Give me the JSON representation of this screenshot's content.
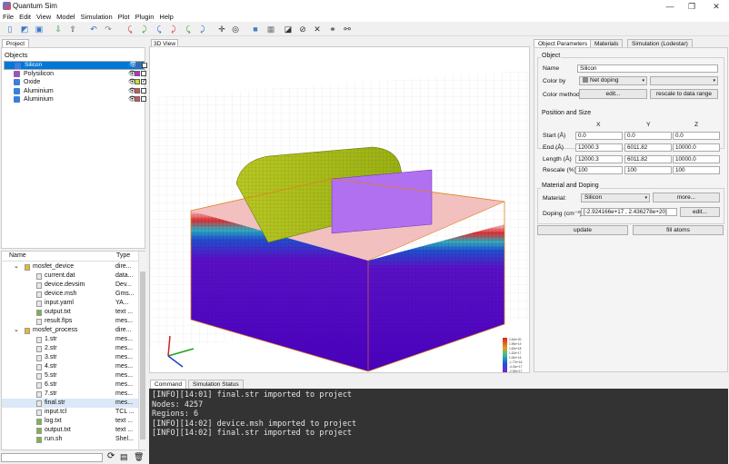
{
  "window": {
    "title": "Quantum Sim",
    "minimize": "—",
    "maximize": "❐",
    "close": "✕"
  },
  "menu": [
    "File",
    "Edit",
    "View",
    "Model",
    "Simulation",
    "Plot",
    "Plugin",
    "Help"
  ],
  "left": {
    "project_tab": "Project",
    "objects_header": "Objects",
    "objects": [
      {
        "label": "Silicon",
        "color": "#3b7fd9",
        "swatch": "#2266dd",
        "checked": true,
        "selected": true
      },
      {
        "label": "Polysilicon",
        "color": "#9b59b6",
        "swatch": "#d020d0",
        "checked": false,
        "selected": false
      },
      {
        "label": "Oxide",
        "color": "#3b7fd9",
        "swatch": "#c8e020",
        "checked": true,
        "selected": false
      },
      {
        "label": "Aluminium",
        "color": "#3b7fd9",
        "swatch": "#e05050",
        "checked": false,
        "selected": false
      },
      {
        "label": "Aluminium",
        "color": "#3b7fd9",
        "swatch": "#e05050",
        "checked": false,
        "selected": false
      }
    ],
    "file_headers": {
      "name": "Name",
      "type": "Type"
    },
    "files": [
      {
        "name": "mosfet_device",
        "type": "dire...",
        "kind": "folder",
        "indent": 0
      },
      {
        "name": "current.dat",
        "type": "data...",
        "kind": "file",
        "indent": 1
      },
      {
        "name": "device.devsim",
        "type": "Dev...",
        "kind": "file",
        "indent": 1
      },
      {
        "name": "device.msh",
        "type": "Gms...",
        "kind": "file",
        "indent": 1
      },
      {
        "name": "input.yaml",
        "type": "YA...",
        "kind": "file",
        "indent": 1
      },
      {
        "name": "output.txt",
        "type": "text ...",
        "kind": "filegreen",
        "indent": 1
      },
      {
        "name": "result.fIps",
        "type": "mes...",
        "kind": "file",
        "indent": 1
      },
      {
        "name": "mosfet_process",
        "type": "dire...",
        "kind": "folder",
        "indent": 0
      },
      {
        "name": "1.str",
        "type": "mes...",
        "kind": "file",
        "indent": 1
      },
      {
        "name": "2.str",
        "type": "mes...",
        "kind": "file",
        "indent": 1
      },
      {
        "name": "3.str",
        "type": "mes...",
        "kind": "file",
        "indent": 1
      },
      {
        "name": "4.str",
        "type": "mes...",
        "kind": "file",
        "indent": 1
      },
      {
        "name": "5.str",
        "type": "mes...",
        "kind": "file",
        "indent": 1
      },
      {
        "name": "6.str",
        "type": "mes...",
        "kind": "file",
        "indent": 1
      },
      {
        "name": "7.str",
        "type": "mes...",
        "kind": "file",
        "indent": 1
      },
      {
        "name": "final.str",
        "type": "mes...",
        "kind": "file",
        "indent": 1
      },
      {
        "name": "input.tcl",
        "type": "TCL ...",
        "kind": "file",
        "indent": 1
      },
      {
        "name": "log.txt",
        "type": "text ...",
        "kind": "filegreen",
        "indent": 1
      },
      {
        "name": "output.txt",
        "type": "text ...",
        "kind": "filegreen",
        "indent": 1
      },
      {
        "name": "run.sh",
        "type": "Shel...",
        "kind": "filegreen",
        "indent": 1
      }
    ]
  },
  "view": {
    "tab": "3D View",
    "axes": {
      "x": "x",
      "y": "y",
      "z": "z"
    }
  },
  "bottom": {
    "tabs": [
      "Command",
      "Simulation Status"
    ],
    "console": [
      "[INFO][14:01] final.str imported to project",
      "Nodes: 4257",
      "Regions: 6",
      "[INFO][14:02] device.msh imported to project",
      "[INFO][14:02] final.str imported to project"
    ]
  },
  "right": {
    "tabs": [
      "Object Parameters",
      "Materials",
      "Simulation (Lodestar)"
    ],
    "object_group": "Object",
    "name_label": "Name",
    "name_value": "Silicon",
    "colorby_label": "Color by",
    "colorby_value": "Net doping",
    "colorby_value2": "",
    "colormethod_label": "Color method",
    "edit_label": "edit...",
    "rescale_label": "rescale to data range",
    "pos_group": "Position and Size",
    "col_x": "X",
    "col_y": "Y",
    "col_z": "Z",
    "start_label": "Start (Å)",
    "start": [
      "0.0",
      "0.0",
      "0.0"
    ],
    "end_label": "End (Å)",
    "end": [
      "12000.3",
      "6011.82",
      "10000.0"
    ],
    "length_label": "Length (Å)",
    "length": [
      "12000.3",
      "6011.82",
      "10000.0"
    ],
    "rescale_pct_label": "Rescale (%)",
    "rescale": [
      "100",
      "100",
      "100"
    ],
    "mat_group": "Material and Doping",
    "material_label": "Material:",
    "material_value": "Silicon",
    "more_label": "more...",
    "doping_label": "Doping (cm⁻³):",
    "doping_value": "[-2.924166e+17 , 2.436278e+20]",
    "doping_edit": "edit...",
    "update_label": "update",
    "fill_label": "fill atoms"
  },
  "colorbar": {
    "labels": [
      "2.44e+20",
      "1.99e+19",
      "1.62e+18",
      "1.32e+17",
      "1.00e+16",
      "-1.77e+16",
      "-4.31e+17",
      "-2.92e+17"
    ]
  }
}
